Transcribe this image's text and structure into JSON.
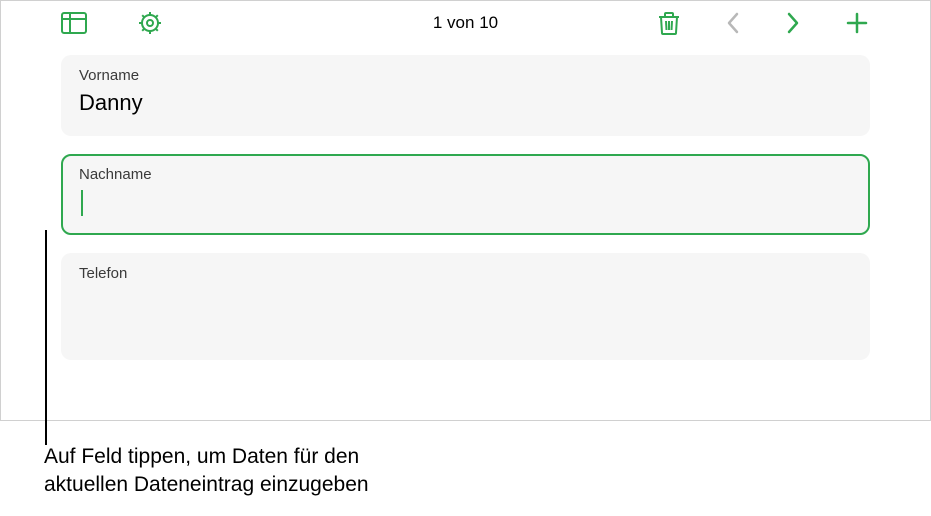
{
  "toolbar": {
    "counter": "1 von 10"
  },
  "fields": {
    "vorname": {
      "label": "Vorname",
      "value": "Danny"
    },
    "nachname": {
      "label": "Nachname",
      "value": ""
    },
    "telefon": {
      "label": "Telefon",
      "value": ""
    }
  },
  "callout": {
    "line1": "Auf Feld tippen, um Daten für den",
    "line2": "aktuellen Dateneintrag einzugeben"
  }
}
